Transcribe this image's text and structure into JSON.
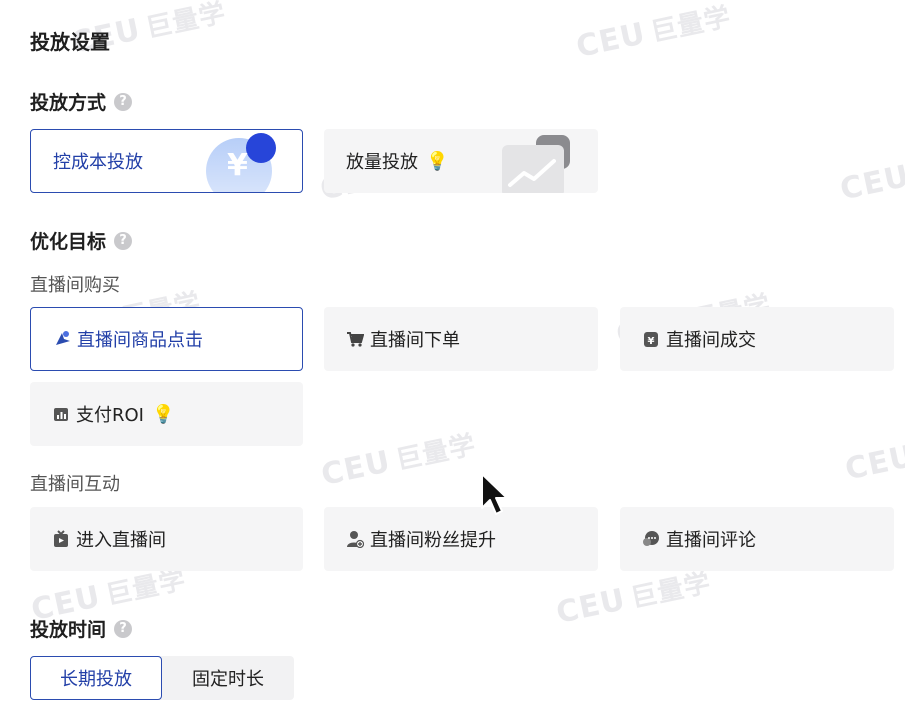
{
  "watermark_text": "巨量学",
  "page_title": "投放设置",
  "delivery_mode": {
    "title": "投放方式",
    "options": [
      {
        "label": "控成本投放",
        "selected": true
      },
      {
        "label": "放量投放",
        "selected": false
      }
    ]
  },
  "optimization": {
    "title": "优化目标",
    "groups": [
      {
        "title": "直播间购买",
        "options": [
          {
            "label": "直播间商品点击",
            "icon": "pin-click-icon",
            "selected": true
          },
          {
            "label": "直播间下单",
            "icon": "cart-icon",
            "selected": false
          },
          {
            "label": "直播间成交",
            "icon": "yen-bag-icon",
            "selected": false
          },
          {
            "label": "支付ROI",
            "icon": "bar-chart-icon",
            "selected": false,
            "badge": "lightbulb-icon"
          }
        ]
      },
      {
        "title": "直播间互动",
        "options": [
          {
            "label": "进入直播间",
            "icon": "tv-enter-icon",
            "selected": false
          },
          {
            "label": "直播间粉丝提升",
            "icon": "user-plus-icon",
            "selected": false
          },
          {
            "label": "直播间评论",
            "icon": "comment-icon",
            "selected": false
          }
        ]
      }
    ]
  },
  "schedule": {
    "title": "投放时间",
    "options": [
      {
        "label": "长期投放",
        "selected": true
      },
      {
        "label": "固定时长",
        "selected": false
      }
    ]
  },
  "colors": {
    "accent": "#2b4cb0",
    "card_bg": "#f5f5f6"
  }
}
